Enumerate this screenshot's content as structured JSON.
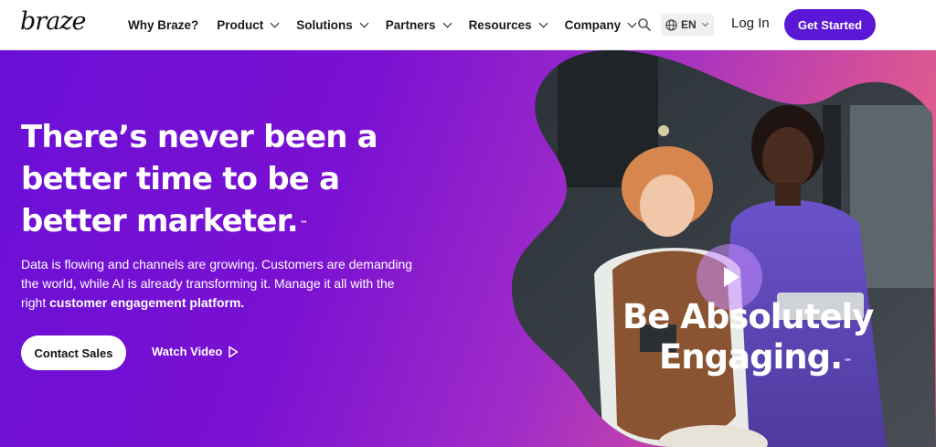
{
  "brand": {
    "logo_text": "braze",
    "accent": "#5a18d6"
  },
  "nav": {
    "items": [
      {
        "label": "Why Braze?",
        "has_dropdown": false
      },
      {
        "label": "Product",
        "has_dropdown": true
      },
      {
        "label": "Solutions",
        "has_dropdown": true
      },
      {
        "label": "Partners",
        "has_dropdown": true
      },
      {
        "label": "Resources",
        "has_dropdown": true
      },
      {
        "label": "Company",
        "has_dropdown": true
      }
    ],
    "search_icon": "search-icon",
    "language": {
      "icon": "globe-icon",
      "code": "EN"
    },
    "login_label": "Log In",
    "cta_label": "Get Started"
  },
  "hero": {
    "headline_lines": [
      "There’s never been a",
      "better time to be a",
      "better marketer."
    ],
    "headline_tm": "™",
    "subtext_plain": "Data is flowing and channels are growing. Customers are demanding the world, while AI is already transforming it. Manage it all with the right ",
    "subtext_bold": "customer engagement platform.",
    "contact_label": "Contact Sales",
    "watch_label": "Watch Video",
    "video": {
      "play_icon": "play-icon",
      "title_line1": "Be Absolutely",
      "title_line2": "Engaging.",
      "title_tm": "™"
    },
    "colors": {
      "gradient_start": "#6a10d6",
      "gradient_end": "#f06e7e"
    }
  }
}
